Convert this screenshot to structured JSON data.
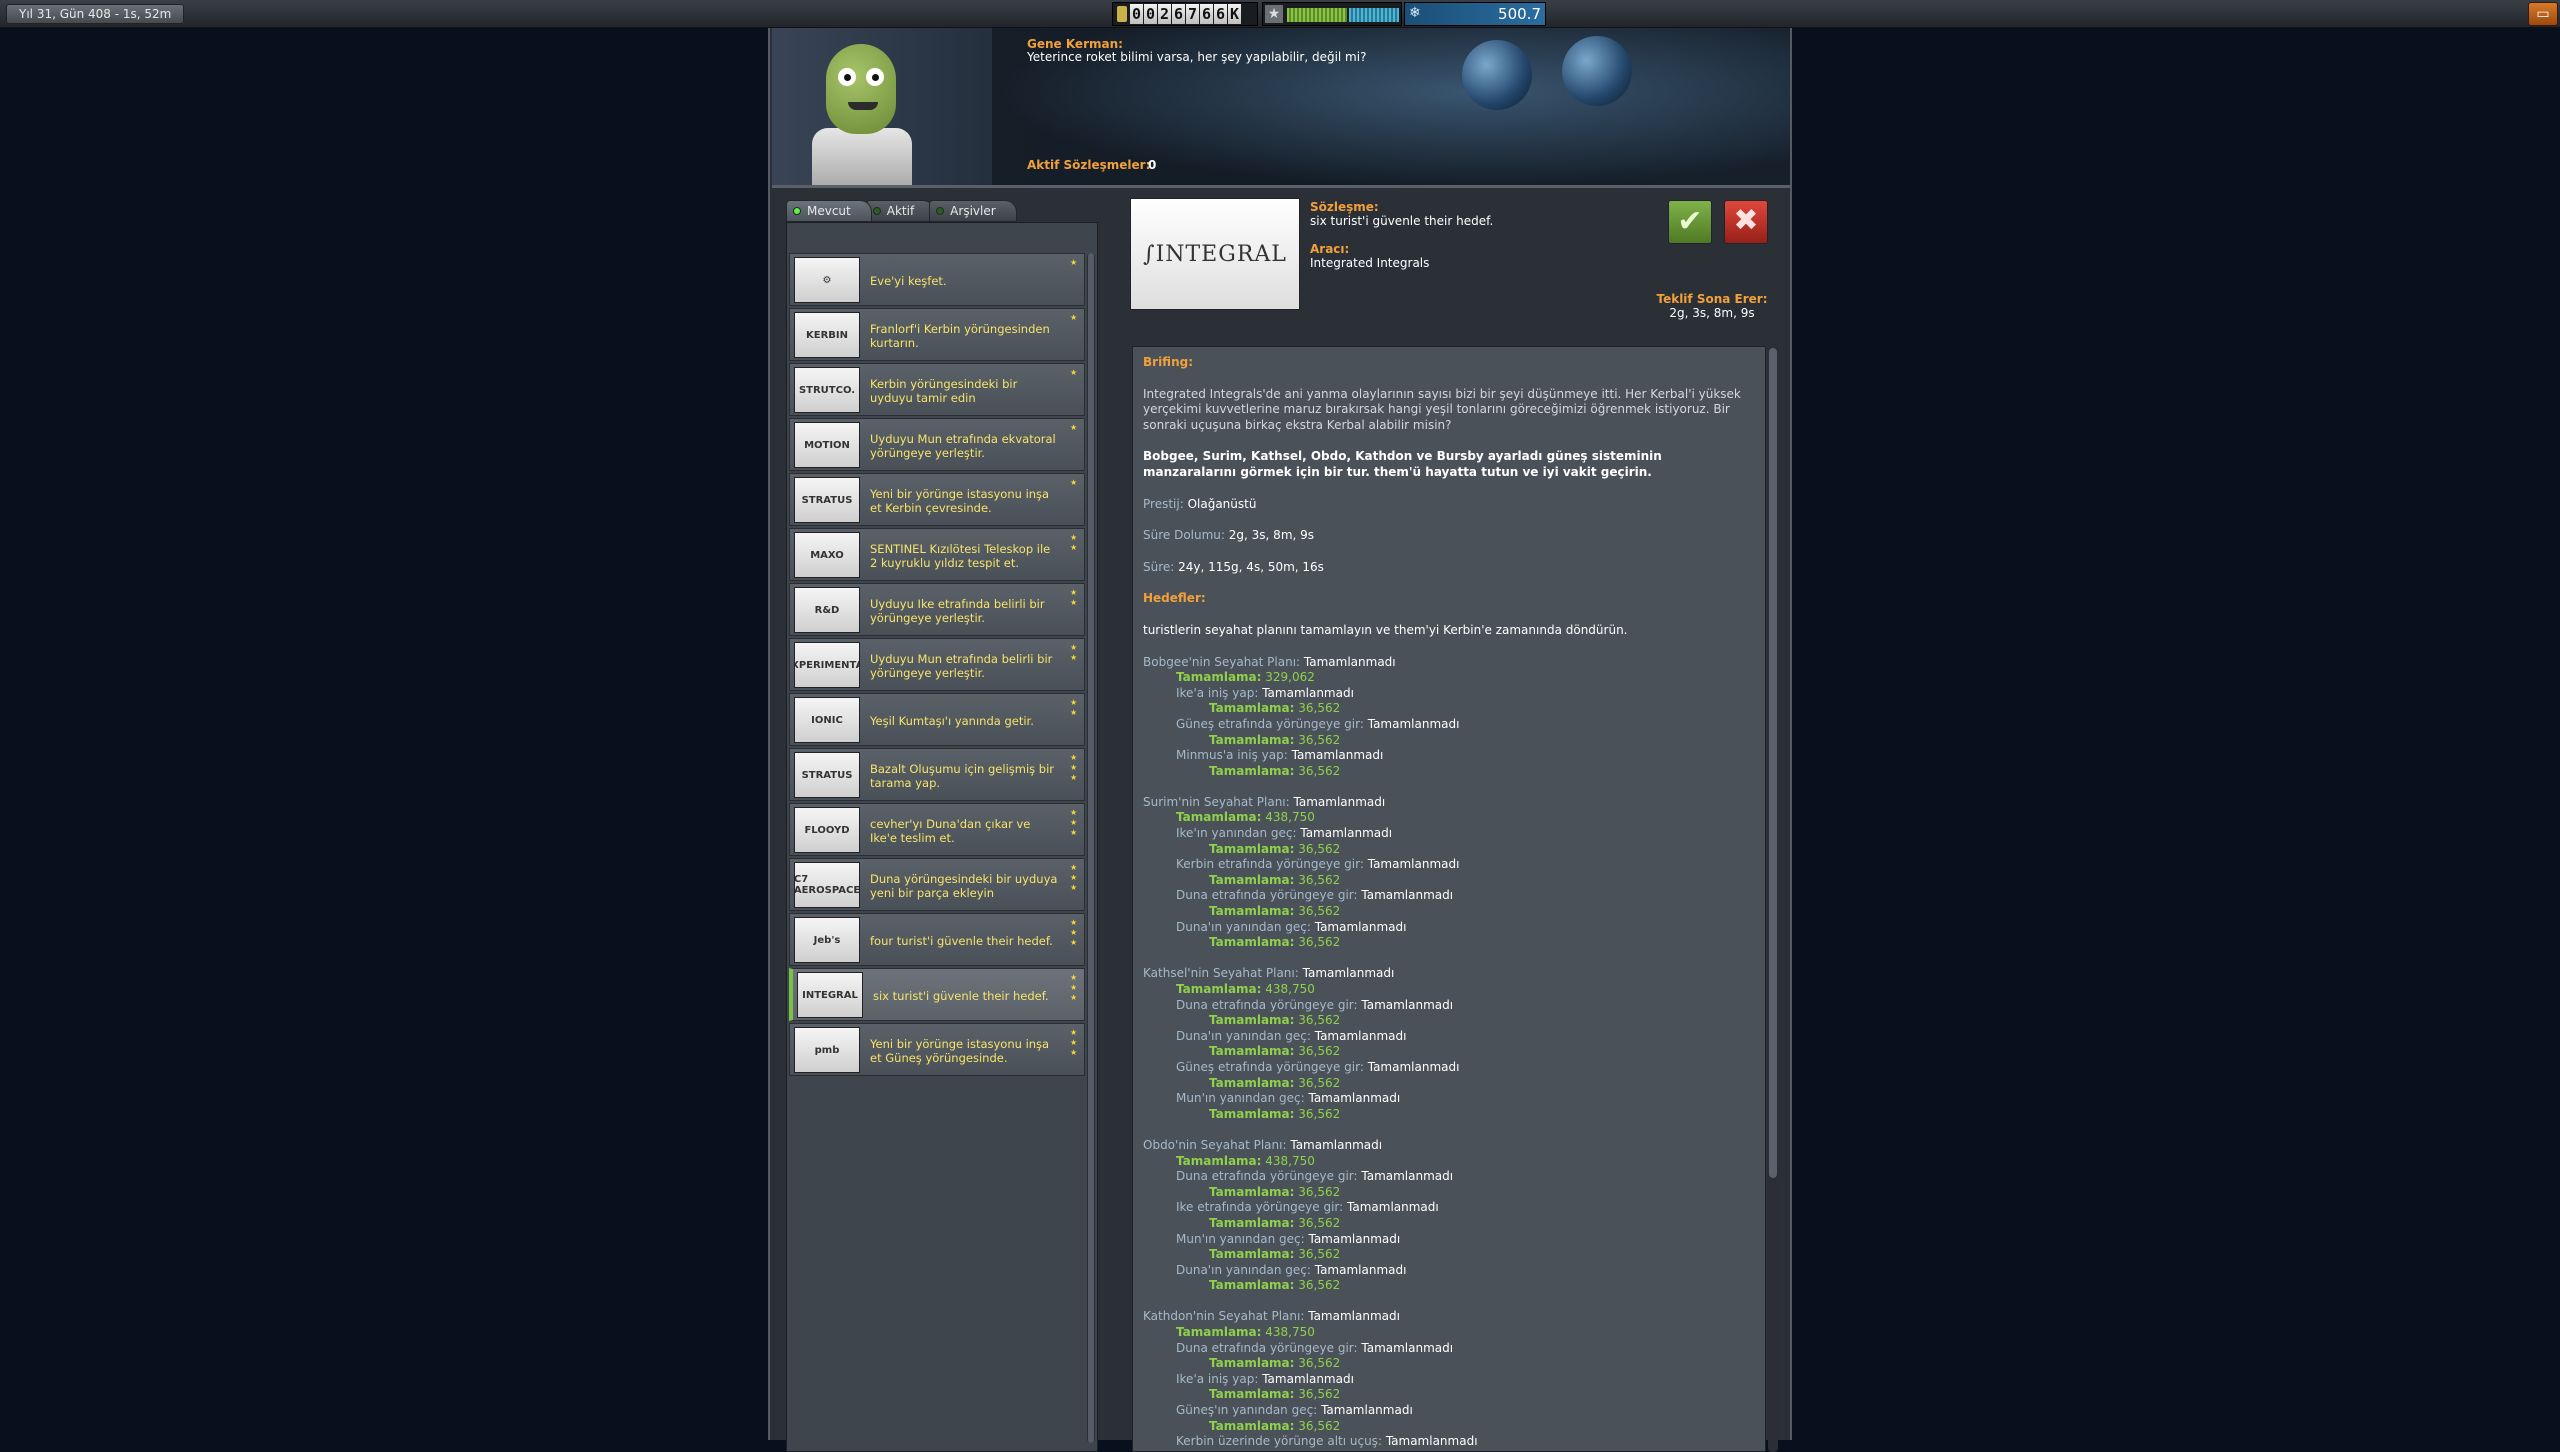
{
  "topbar": {
    "date": "Yıl 31, Gün 408 - 1s, 52m",
    "funds_digits": [
      "0",
      "0",
      "2",
      "6",
      "7",
      "6",
      "6",
      "K"
    ],
    "science": "500.7"
  },
  "header": {
    "speaker": "Gene Kerman:",
    "quote": "Yeterince roket bilimi varsa, her şey yapılabilir, değil mi?",
    "active_label": "Aktif Sözleşmeler:",
    "active_count": "0"
  },
  "tabs": [
    {
      "label": "Mevcut"
    },
    {
      "label": "Aktif"
    },
    {
      "label": "Arşivler"
    }
  ],
  "contracts": [
    {
      "logo": "⚙",
      "title": "Eve'yi keşfet.",
      "stars": 1
    },
    {
      "logo": "KERBIN",
      "title": "Franlorf'i Kerbin yörüngesinden kurtarın.",
      "stars": 1
    },
    {
      "logo": "STRUTCO.",
      "title": "Kerbin yörüngesindeki bir uyduyu tamir edin",
      "stars": 1
    },
    {
      "logo": "MOTION",
      "title": "Uyduyu Mun etrafında ekvatoral yörüngeye yerleştir.",
      "stars": 1
    },
    {
      "logo": "STRATUS",
      "title": "Yeni bir yörünge istasyonu inşa et Kerbin çevresinde.",
      "stars": 1
    },
    {
      "logo": "MAXO",
      "title": "SENTINEL Kızılötesi Teleskop ile 2 kuyruklu yıldız tespit et.",
      "stars": 2
    },
    {
      "logo": "R&D",
      "title": "Uyduyu Ike etrafında belirli bir yörüngeye yerleştir.",
      "stars": 2
    },
    {
      "logo": "EXPERIMENTAL",
      "title": "Uyduyu Mun etrafında belirli bir yörüngeye yerleştir.",
      "stars": 2
    },
    {
      "logo": "IONIC",
      "title": "Yeşil Kumtaşı'ı yanında getir.",
      "stars": 2
    },
    {
      "logo": "STRATUS",
      "title": "Bazalt Oluşumu için gelişmiş bir tarama yap.",
      "stars": 3
    },
    {
      "logo": "FLOOYD",
      "title": "cevher'yı Duna'dan çıkar ve Ike'e teslim et.",
      "stars": 3
    },
    {
      "logo": "C7 AEROSPACE",
      "title": "Duna yörüngesindeki bir uyduya yeni bir parça ekleyin",
      "stars": 3
    },
    {
      "logo": "Jeb's",
      "title": "four turist'i güvenle their hedef.",
      "stars": 3
    },
    {
      "logo": "INTEGRAL",
      "title": "six turist'i güvenle their hedef.",
      "stars": 3
    },
    {
      "logo": "pmb",
      "title": "Yeni bir yörünge istasyonu inşa et Güneş yörüngesinde.",
      "stars": 3
    }
  ],
  "detail": {
    "agency_logo": "∫INTEGRAL",
    "contract_label": "Sözleşme:",
    "contract_title": "six turist'i güvenle their hedef.",
    "agent_label": "Aracı:",
    "agent": "Integrated Integrals",
    "offer_label": "Teklif Sona Erer:",
    "offer_value": "2g, 3s, 8m, 9s",
    "briefing_label": "Brifing:",
    "briefing": "Integrated Integrals'de ani yanma olaylarının sayısı bizi bir şeyi düşünmeye itti. Her Kerbal'i yüksek yerçekimi kuvvetlerine maruz bırakırsak hangi yeşil tonlarını göreceğimizi öğrenmek istiyoruz. Bir sonraki uçuşuna birkaç ekstra Kerbal alabilir misin?",
    "highlight": "Bobgee, Surim, Kathsel, Obdo, Kathdon ve Bursby ayarladı güneş sisteminin manzaralarını görmek için bir tur. them'ü hayatta tutun ve iyi vakit geçirin.",
    "prestige_k": "Prestij:",
    "prestige_v": "Olağanüstü",
    "deadline_k": "Süre Dolumu:",
    "deadline_v": "2g, 3s, 8m, 9s",
    "duration_k": "Süre:",
    "duration_v": "24y, 115g, 4s, 50m, 16s",
    "goals_label": "Hedefler:",
    "goal_text": "turistlerin seyahat planını tamamlayın ve them'yi Kerbin'e zamanında döndürün.",
    "complete_k": "Tamamlama:",
    "status": "Tamamlanmadı",
    "plans": [
      {
        "name": "Bobgee'nin Seyahat Planı:",
        "reward": "329,062",
        "steps": [
          {
            "name": "Ike'a iniş yap:",
            "reward": "36,562"
          },
          {
            "name": "Güneş etrafında yörüngeye gir:",
            "reward": "36,562"
          },
          {
            "name": "Minmus'a iniş yap:",
            "reward": "36,562"
          }
        ]
      },
      {
        "name": "Surim'nin Seyahat Planı:",
        "reward": "438,750",
        "steps": [
          {
            "name": "Ike'ın yanından geç:",
            "reward": "36,562"
          },
          {
            "name": "Kerbin etrafında yörüngeye gir:",
            "reward": "36,562"
          },
          {
            "name": "Duna etrafında yörüngeye gir:",
            "reward": "36,562"
          },
          {
            "name": "Duna'ın yanından geç:",
            "reward": "36,562"
          }
        ]
      },
      {
        "name": "Kathsel'nin Seyahat Planı:",
        "reward": "438,750",
        "steps": [
          {
            "name": "Duna etrafında yörüngeye gir:",
            "reward": "36,562"
          },
          {
            "name": "Duna'ın yanından geç:",
            "reward": "36,562"
          },
          {
            "name": "Güneş etrafında yörüngeye gir:",
            "reward": "36,562"
          },
          {
            "name": "Mun'ın yanından geç:",
            "reward": "36,562"
          }
        ]
      },
      {
        "name": "Obdo'nin Seyahat Planı:",
        "reward": "438,750",
        "steps": [
          {
            "name": "Duna etrafında yörüngeye gir:",
            "reward": "36,562"
          },
          {
            "name": "Ike etrafında yörüngeye gir:",
            "reward": "36,562"
          },
          {
            "name": "Mun'ın yanından geç:",
            "reward": "36,562"
          },
          {
            "name": "Duna'ın yanından geç:",
            "reward": "36,562"
          }
        ]
      },
      {
        "name": "Kathdon'nin Seyahat Planı:",
        "reward": "438,750",
        "steps": [
          {
            "name": "Duna etrafında yörüngeye gir:",
            "reward": "36,562"
          },
          {
            "name": "Ike'a iniş yap:",
            "reward": "36,562"
          },
          {
            "name": "Güneş'ın yanından geç:",
            "reward": "36,562"
          },
          {
            "name": "Kerbin üzerinde yörünge altı uçuş:",
            "reward": null
          }
        ]
      }
    ]
  }
}
